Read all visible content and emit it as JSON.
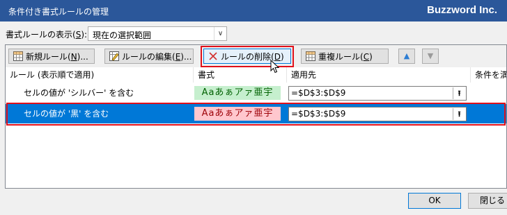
{
  "window": {
    "title": "条件付き書式ルールの管理",
    "brand": "Buzzword Inc."
  },
  "show_rules": {
    "label_prefix": "書式ルールの表示(",
    "label_key": "S",
    "label_suffix": "):",
    "selected": "現在の選択範囲"
  },
  "toolbar": {
    "new_rule": {
      "text": "新規ルール(",
      "key": "N",
      "suffix": ")..."
    },
    "edit_rule": {
      "text": "ルールの編集(",
      "key": "E",
      "suffix": ")..."
    },
    "delete_rule": {
      "text": "ルールの削除(",
      "key": "D",
      "suffix": ")"
    },
    "duplicate_rule": {
      "text": "重複ルール(",
      "key": "C",
      "suffix": ")"
    },
    "move_up": "▲",
    "move_down": "▼"
  },
  "columns": {
    "rule": "ルール (表示順で適用)",
    "format": "書式",
    "applies_to": "適用先",
    "stop_if_true": "条件を満"
  },
  "rules": [
    {
      "rule": "セルの値が 'シルバー' を含む",
      "format_sample": "Aaあぁアァ亜宇",
      "applies_to": "=$D$3:$D$9",
      "selected": false
    },
    {
      "rule": "セルの値が '黒' を含む",
      "format_sample": "Aaあぁアァ亜宇",
      "applies_to": "=$D$3:$D$9",
      "selected": true
    }
  ],
  "footer": {
    "ok": "OK",
    "close": "閉じる"
  },
  "colors": {
    "titlebar": "#2b579a",
    "selection": "#0078d7",
    "highlight": "#e0101a",
    "green_fill": "#c6efce",
    "green_text": "#006100",
    "red_fill": "#ffc7ce",
    "red_text": "#9c0006"
  }
}
